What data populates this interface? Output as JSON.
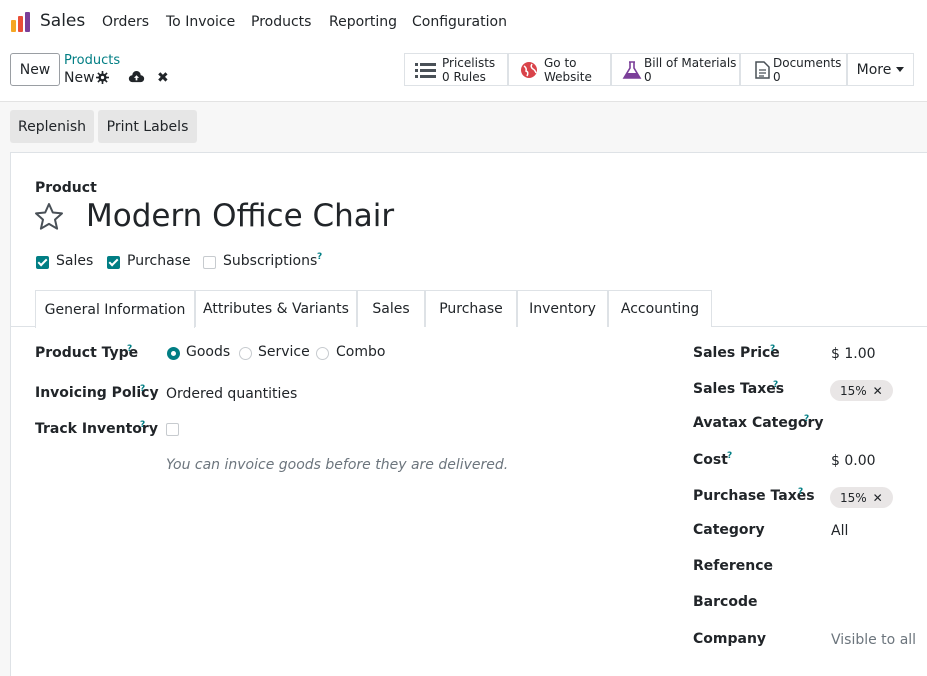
{
  "navbar": {
    "app_name": "Sales",
    "menu": [
      "Orders",
      "To Invoice",
      "Products",
      "Reporting",
      "Configuration"
    ]
  },
  "control_panel": {
    "new_label": "New",
    "breadcrumb_parent": "Products",
    "breadcrumb_current": "New",
    "smart_buttons": [
      {
        "line1": "Pricelists",
        "count": "0",
        "suffix": "Rules",
        "icon": "list-icon"
      },
      {
        "line1": "Go to",
        "line2": "Website",
        "icon": "globe-icon"
      },
      {
        "line1": "Bill of Materials",
        "count": "0",
        "icon": "flask-icon"
      },
      {
        "line1": "Documents",
        "count": "0",
        "icon": "file-icon"
      }
    ],
    "more_label": "More"
  },
  "actions": {
    "replenish": "Replenish",
    "print_labels": "Print Labels"
  },
  "form": {
    "product_label": "Product",
    "product_name": "Modern Office Chair",
    "checkboxes": [
      {
        "label": "Sales",
        "checked": true
      },
      {
        "label": "Purchase",
        "checked": true
      },
      {
        "label": "Subscriptions",
        "checked": false,
        "help": "?"
      }
    ],
    "tabs": [
      "General Information",
      "Attributes & Variants",
      "Sales",
      "Purchase",
      "Inventory",
      "Accounting"
    ],
    "active_tab": "General Information",
    "left": {
      "product_type_label": "Product Type",
      "product_type_options": [
        "Goods",
        "Service",
        "Combo"
      ],
      "product_type_selected": "Goods",
      "invoicing_policy_label": "Invoicing Policy",
      "invoicing_policy_value": "Ordered quantities",
      "track_inventory_label": "Track Inventory",
      "note": "You can invoice goods before they are delivered."
    },
    "right": {
      "sales_price_label": "Sales Price",
      "sales_price_value": "$ 1.00",
      "sales_taxes_label": "Sales Taxes",
      "sales_taxes_tag": "15%",
      "avatax_label": "Avatax Category",
      "cost_label": "Cost",
      "cost_value": "$ 0.00",
      "purchase_taxes_label": "Purchase Taxes",
      "purchase_taxes_tag": "15%",
      "category_label": "Category",
      "category_value": "All",
      "reference_label": "Reference",
      "barcode_label": "Barcode",
      "company_label": "Company",
      "company_placeholder": "Visible to all"
    },
    "help_mark": "?",
    "tag_remove": "✕"
  },
  "colors": {
    "accent": "#017e84",
    "logo": [
      "#f5a623",
      "#e94f37",
      "#7b3f99"
    ]
  }
}
